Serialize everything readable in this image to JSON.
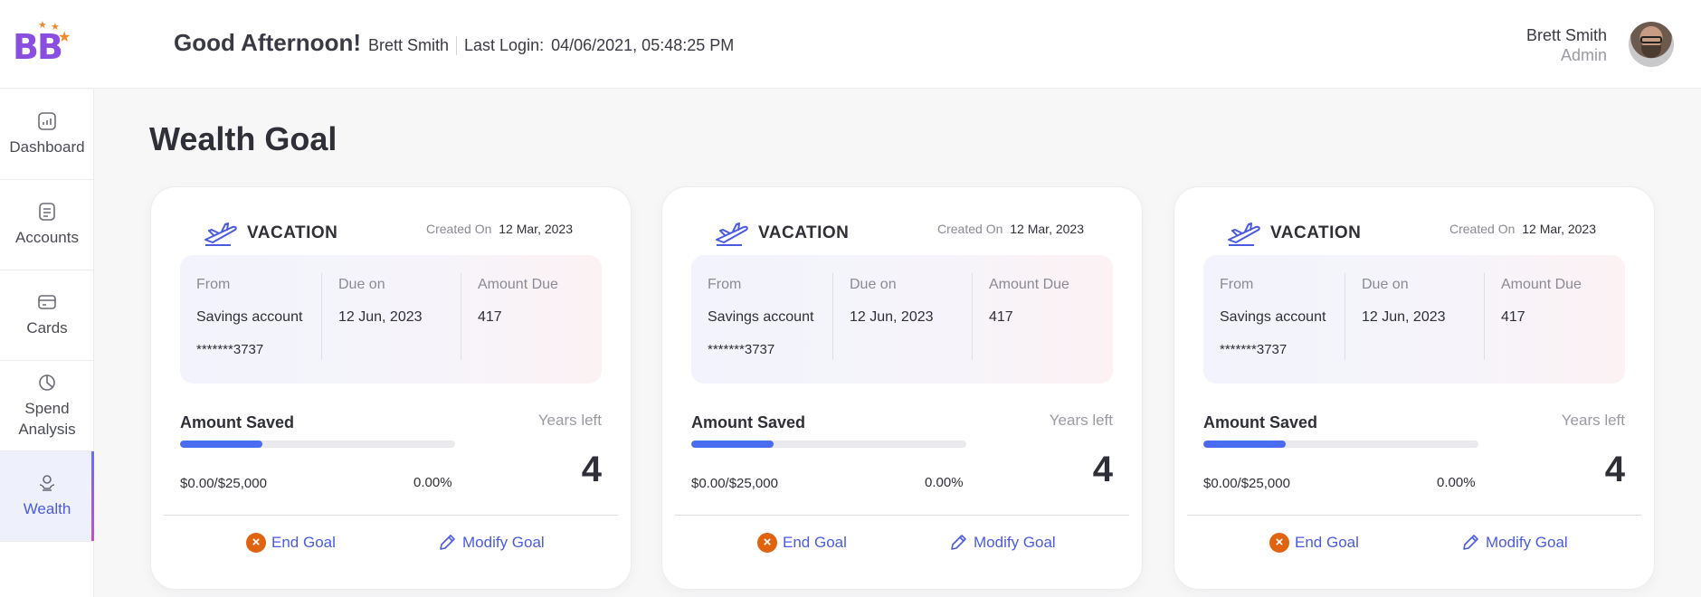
{
  "app": {
    "logo_text": "BB"
  },
  "header": {
    "greeting": "Good Afternoon!",
    "user_name": "Brett Smith",
    "last_login_label": "Last Login:",
    "last_login_value": "04/06/2021, 05:48:25 PM",
    "profile_name": "Brett Smith",
    "profile_role": "Admin"
  },
  "sidebar": {
    "items": [
      {
        "label": "Dashboard",
        "icon": "dashboard-icon",
        "active": false
      },
      {
        "label": "Accounts",
        "icon": "accounts-icon",
        "active": false
      },
      {
        "label": "Cards",
        "icon": "card-icon",
        "active": false
      },
      {
        "label": "Spend Analysis",
        "icon": "pie-chart-icon",
        "active": false
      },
      {
        "label": "Wealth",
        "icon": "wealth-icon",
        "active": true
      }
    ]
  },
  "page": {
    "title": "Wealth Goal"
  },
  "colors": {
    "accent": "#4a5be0",
    "progress": "#4a6cf0",
    "danger": "#e06410",
    "logo": "#8a4fe0"
  },
  "goals": [
    {
      "title": "VACATION",
      "icon": "airplane-icon",
      "created_label": "Created On",
      "created_value": "12 Mar, 2023",
      "from_label": "From",
      "from_value": "Savings account",
      "from_account": "*******3737",
      "due_label": "Due on",
      "due_value": "12 Jun, 2023",
      "amount_due_label": "Amount Due",
      "amount_due_value": "417",
      "saved_label": "Amount Saved",
      "years_left_label": "Years left",
      "amount_text": "$0.00/$25,000",
      "percent_text": "0.00%",
      "progress_fraction": 0.3,
      "years_left_value": "4",
      "end_label": "End Goal",
      "modify_label": "Modify Goal"
    },
    {
      "title": "VACATION",
      "icon": "airplane-icon",
      "created_label": "Created On",
      "created_value": "12 Mar, 2023",
      "from_label": "From",
      "from_value": "Savings account",
      "from_account": "*******3737",
      "due_label": "Due on",
      "due_value": "12 Jun, 2023",
      "amount_due_label": "Amount Due",
      "amount_due_value": "417",
      "saved_label": "Amount Saved",
      "years_left_label": "Years left",
      "amount_text": "$0.00/$25,000",
      "percent_text": "0.00%",
      "progress_fraction": 0.3,
      "years_left_value": "4",
      "end_label": "End Goal",
      "modify_label": "Modify Goal"
    },
    {
      "title": "VACATION",
      "icon": "airplane-icon",
      "created_label": "Created On",
      "created_value": "12 Mar, 2023",
      "from_label": "From",
      "from_value": "Savings account",
      "from_account": "*******3737",
      "due_label": "Due on",
      "due_value": "12 Jun, 2023",
      "amount_due_label": "Amount Due",
      "amount_due_value": "417",
      "saved_label": "Amount Saved",
      "years_left_label": "Years left",
      "amount_text": "$0.00/$25,000",
      "percent_text": "0.00%",
      "progress_fraction": 0.3,
      "years_left_value": "4",
      "end_label": "End Goal",
      "modify_label": "Modify Goal"
    }
  ]
}
